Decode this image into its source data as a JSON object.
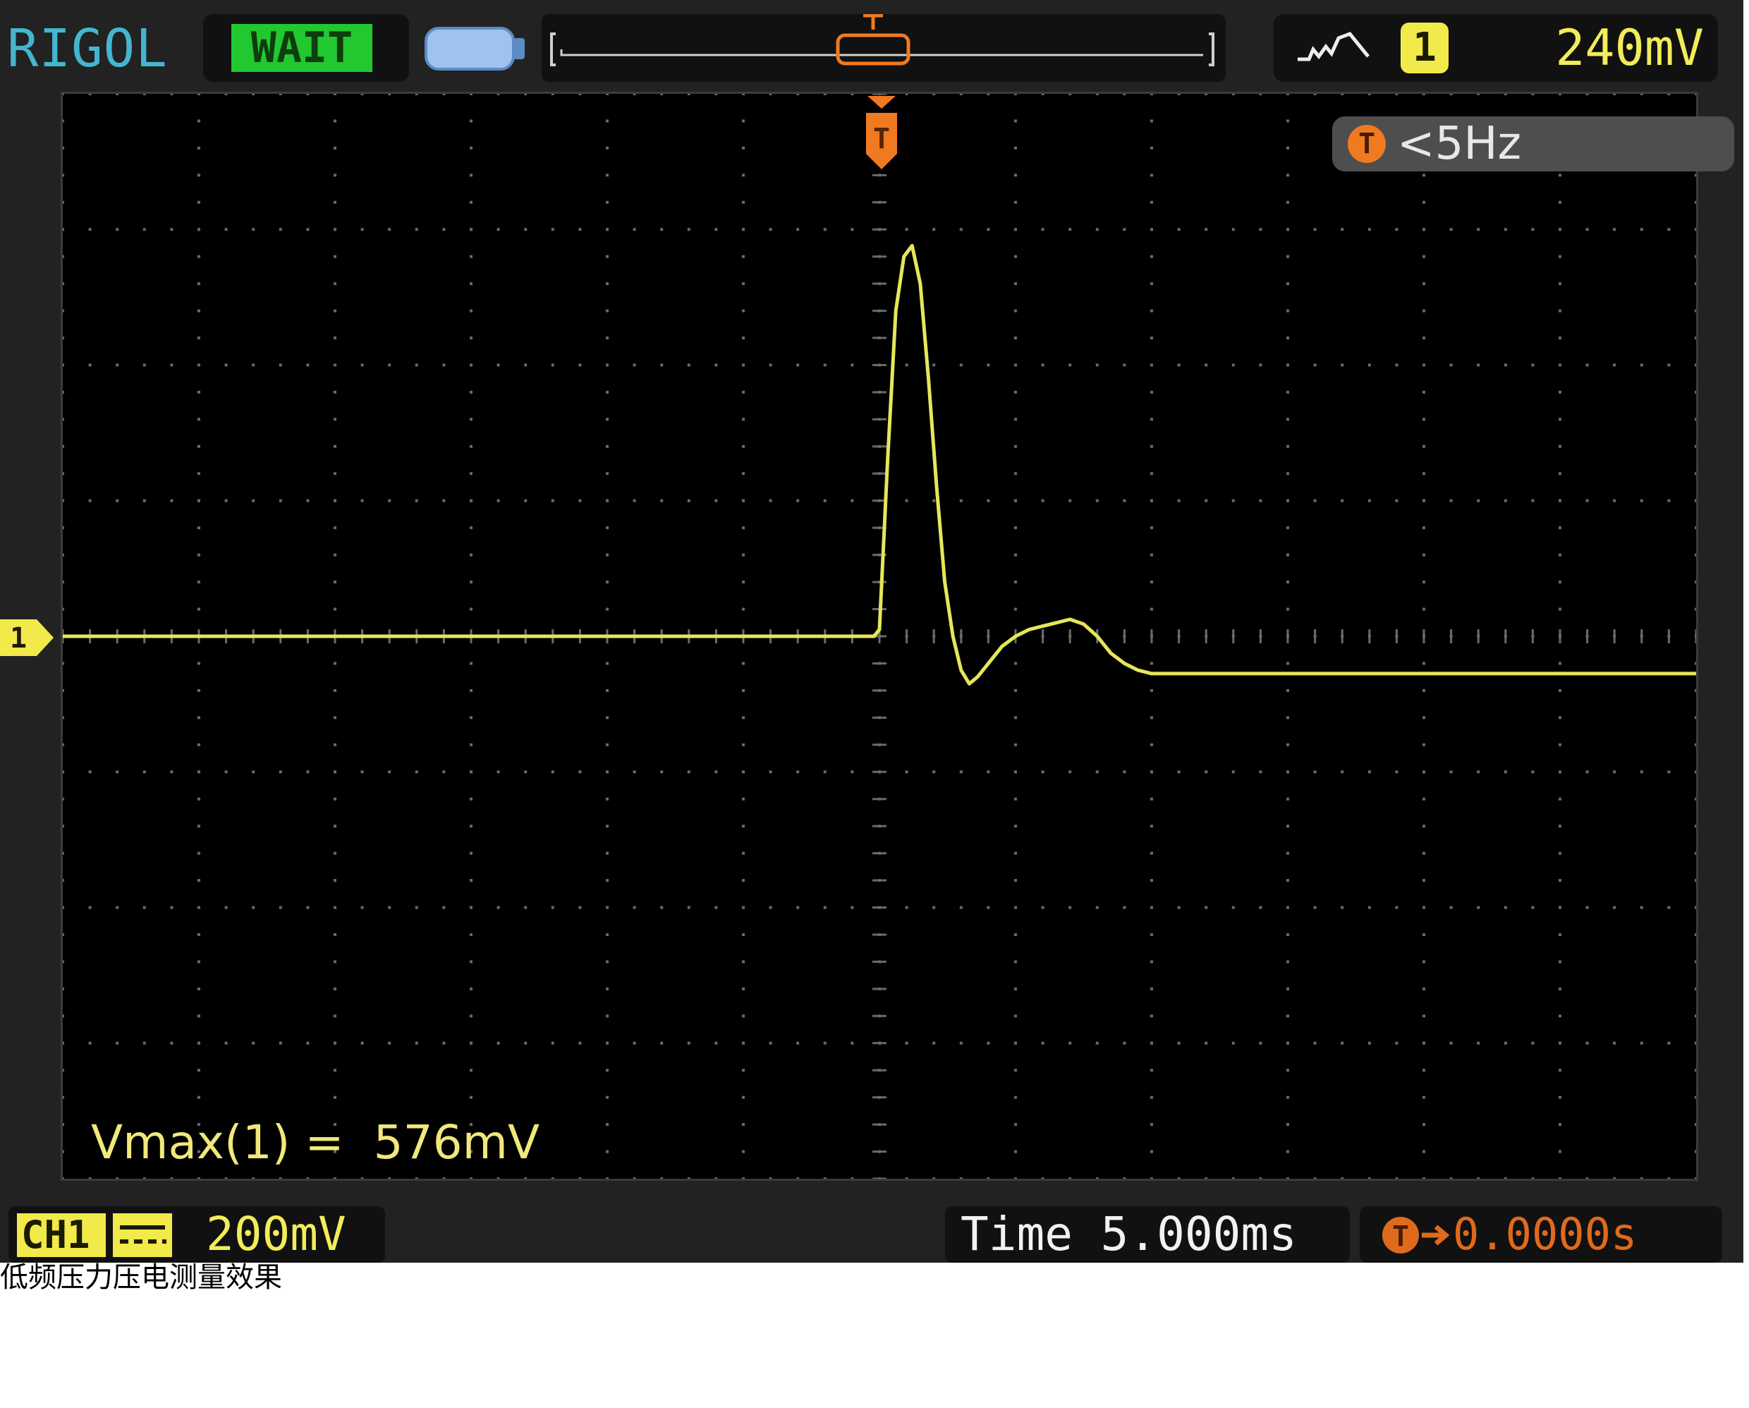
{
  "top_bar": {
    "brand": "RIGOL",
    "status": "WAIT",
    "trigger_channel": "1",
    "trigger_level": "240mV"
  },
  "screen": {
    "trigger_marker": "T",
    "ch1_marker": "1",
    "frequency_icon": "T",
    "frequency": "<5Hz",
    "measurement": "Vmax(1) =  576mV"
  },
  "bottom_bar": {
    "channel_label": "CH1",
    "channel_scale": "200mV",
    "timebase": "Time 5.000ms",
    "trigger_delay": "0.0000s"
  },
  "caption": "低频压力压电测量效果",
  "icons": {
    "battery": "battery-icon",
    "memory_depth": "waveform-memory-icon",
    "trigger_edge": "rising-edge-icon",
    "coupling": "dc-coupling-icon",
    "delay": "trigger-delay-icon"
  },
  "colors": {
    "trace": "#e6e65a",
    "brand": "#45b6cf",
    "status_bg": "#22c830",
    "trigger": "#f07a20",
    "grid_dot": "#6a6a6a"
  },
  "chart_data": {
    "type": "line",
    "title": "",
    "xlabel": "",
    "ylabel": "",
    "x_unit": "ms",
    "y_unit": "mV",
    "xlim": [
      -30,
      30
    ],
    "ylim": [
      -800,
      800
    ],
    "x_div": 5,
    "y_div": 200,
    "grid": true,
    "series": [
      {
        "x": [
          -30,
          -25,
          -20,
          -15,
          -10,
          -5,
          -0.2,
          0,
          0.3,
          0.6,
          0.9,
          1.2,
          1.5,
          1.8,
          2.1,
          2.4,
          2.7,
          3.0,
          3.3,
          3.6,
          4.0,
          4.5,
          5.0,
          5.5,
          6.0,
          6.5,
          7.0,
          7.5,
          8.0,
          8.5,
          9.0,
          9.5,
          10,
          11,
          15,
          20,
          25,
          30
        ],
        "y": [
          0,
          0,
          0,
          0,
          0,
          0,
          0,
          10,
          260,
          480,
          560,
          576,
          520,
          380,
          220,
          80,
          0,
          -50,
          -70,
          -60,
          -40,
          -15,
          0,
          10,
          15,
          20,
          25,
          18,
          0,
          -25,
          -40,
          -50,
          -55,
          -55,
          -55,
          -55,
          -55,
          -55
        ]
      }
    ]
  }
}
